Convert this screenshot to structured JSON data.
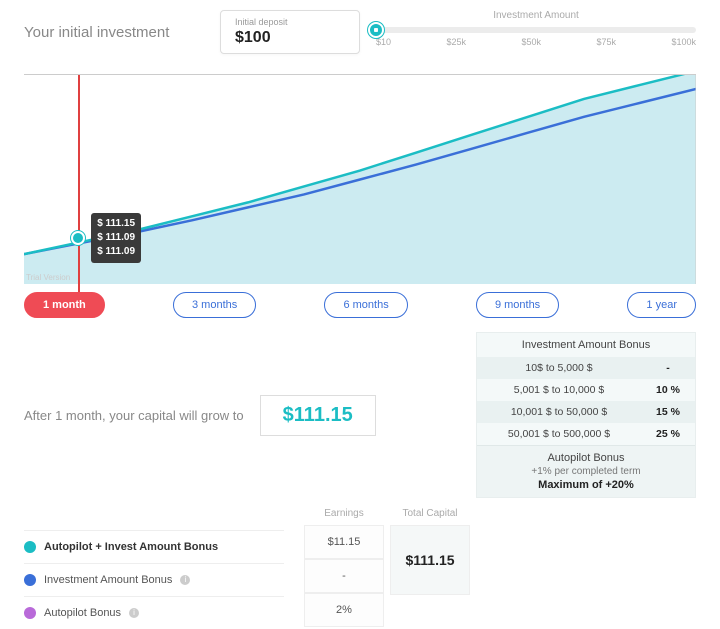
{
  "header": {
    "title": "Your initial investment",
    "deposit_label": "Initial deposit",
    "deposit_value": "$100"
  },
  "slider": {
    "label": "Investment Amount",
    "ticks": [
      "$10",
      "$25k",
      "$50k",
      "$75k",
      "$100k"
    ]
  },
  "chart_data": {
    "type": "area",
    "title": "",
    "xlabel": "",
    "ylabel": "",
    "x": [
      0,
      1,
      2,
      3,
      4,
      5,
      6,
      7,
      8,
      9,
      10,
      11,
      12
    ],
    "ylim": [
      100,
      380
    ],
    "series": [
      {
        "name": "Autopilot + Invest Amount Bonus",
        "color": "#1bbdc4",
        "values": [
          100,
          111.15,
          123,
          137,
          152,
          169,
          188,
          209,
          233,
          259,
          288,
          320,
          356
        ]
      },
      {
        "name": "Investment Amount Bonus",
        "color": "#3a6fd8",
        "values": [
          100,
          111.09,
          122,
          134,
          148,
          163,
          180,
          198,
          218,
          240,
          264,
          291,
          320
        ]
      },
      {
        "name": "Autopilot Bonus",
        "color": "#b96ad9",
        "values": [
          100,
          111.09,
          122,
          134,
          148,
          163,
          180,
          198,
          218,
          240,
          264,
          291,
          320
        ]
      }
    ],
    "marker_month": 1,
    "watermark": "Trial Version"
  },
  "tooltip": {
    "v1": "$ 111.15",
    "v2": "$ 111.09",
    "v3": "$ 111.09"
  },
  "periods": {
    "items": [
      {
        "label": "1 month",
        "active": true
      },
      {
        "label": "3 months",
        "active": false
      },
      {
        "label": "6 months",
        "active": false
      },
      {
        "label": "9 months",
        "active": false
      },
      {
        "label": "1 year",
        "active": false
      }
    ]
  },
  "growth": {
    "text": "After 1 month, your capital will grow to",
    "value": "$111.15"
  },
  "bonus_table": {
    "title": "Investment Amount Bonus",
    "rows": [
      {
        "range": "10$ to 5,000 $",
        "pct": "-"
      },
      {
        "range": "5,001 $ to 10,000 $",
        "pct": "10 %"
      },
      {
        "range": "10,001 $ to 50,000 $",
        "pct": "15 %"
      },
      {
        "range": "50,001 $ to 500,000 $",
        "pct": "25 %"
      }
    ]
  },
  "autopilot": {
    "title": "Autopilot Bonus",
    "sub": "+1% per completed term",
    "max": "Maximum of +20%"
  },
  "legend": {
    "series": [
      {
        "label": "Autopilot + Invest Amount Bonus",
        "color": "teal",
        "bold": true,
        "info": false
      },
      {
        "label": "Investment Amount Bonus",
        "color": "blue",
        "bold": false,
        "info": true
      },
      {
        "label": "Autopilot Bonus",
        "color": "purple",
        "bold": false,
        "info": true
      }
    ]
  },
  "mini": {
    "headers": {
      "earnings": "Earnings",
      "total": "Total Capital"
    },
    "earnings": [
      "$11.15",
      "-",
      "2%"
    ],
    "total": "$111.15"
  }
}
